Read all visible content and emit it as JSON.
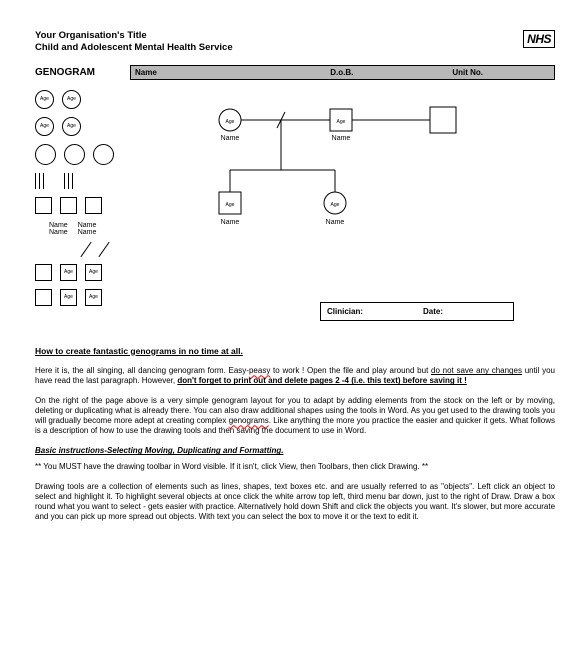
{
  "header": {
    "org_line1": "Your Organisation's Title",
    "org_line2": "Child and Adolescent Mental Health Service",
    "badge": "NHS"
  },
  "section": {
    "title": "GENOGRAM",
    "field_name": "Name",
    "field_dob": "D.o.B.",
    "field_unit": "Unit No."
  },
  "stock": {
    "age": "Age",
    "name": "Name"
  },
  "diagram": {
    "age": "Age",
    "name": "Name"
  },
  "clinician_box": {
    "clinician": "Clinician:",
    "date": "Date:"
  },
  "body": {
    "heading": "How to create fantastic genograms in no time at all.",
    "p1a": "Here it is, the all singing, all dancing genogram form.  Easy-",
    "p1_peasy": "peasy",
    "p1b": " to work !  Open the file and play around but ",
    "p1c": "do not save any changes",
    "p1d": " until you have read the last paragraph.  However, ",
    "p1e": "don't forget to print out and delete pages 2 -4  (i.e. this text) before saving it !",
    "p2a": "On the right of the page above is a very simple genogram layout for you to adapt by adding elements from the stock on the left or by moving, deleting or duplicating what is already there.  You can also draw additional shapes using the tools in Word.  As you get used to the drawing tools you will gradually become more adept at creating complex ",
    "p2_geno": "genograms",
    "p2b": ".   Like anything the more you practice the easier and quicker it gets.  What follows is a description of how to use the drawing tools and then saving the document to use in Word.",
    "sub": "Basic instructions-Selecting Moving, Duplicating and Formatting.",
    "p3": "** You MUST have the drawing toolbar in Word visible.  If it isn't, click View, then Toolbars, then click Drawing. **",
    "p4": "Drawing tools are a collection of elements such as lines, shapes, text boxes etc. and are usually referred to as \"objects\".  Left click an object to select and highlight it.  To highlight several objects at once click the white arrow top left, third menu bar down, just to the right of Draw.  Draw a box round what you want to select - gets easier with practice.  Alternatively hold down Shift and click the objects you want.  It's slower, but more accurate and you can pick up more spread out objects.  With text you can select the box to move it or the text to edit it."
  }
}
